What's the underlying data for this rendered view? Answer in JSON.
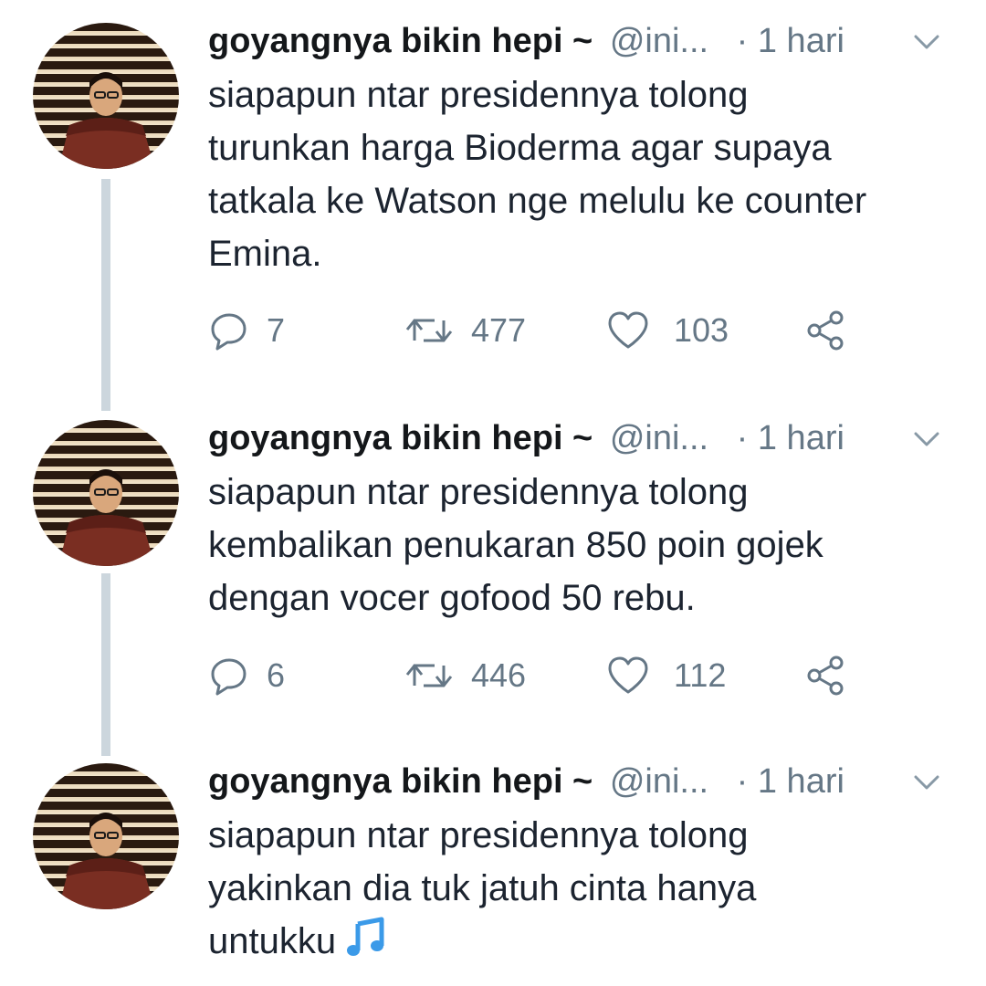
{
  "tweets": [
    {
      "display_name": "goyangnya bikin hepi ~",
      "handle": "@ini...",
      "time": "· 1 hari",
      "text_lines": [
        "siapapun ntar presidennya tolong",
        "turunkan harga Bioderma agar supaya",
        "tatkala ke Watson nge melulu ke counter",
        "Emina."
      ],
      "replies": "7",
      "retweets": "477",
      "likes": "103"
    },
    {
      "display_name": "goyangnya bikin hepi ~",
      "handle": "@ini...",
      "time": "· 1 hari",
      "text_lines": [
        "siapapun ntar presidennya tolong",
        "kembalikan penukaran 850 poin gojek",
        "dengan vocer gofood 50 rebu."
      ],
      "replies": "6",
      "retweets": "446",
      "likes": "112"
    },
    {
      "display_name": "goyangnya bikin hepi ~",
      "handle": "@ini...",
      "time": "· 1 hari",
      "text_lines": [
        "siapapun ntar presidennya tolong",
        "yakinkan dia tuk jatuh cinta hanya",
        "untukku"
      ],
      "emoji": "music-note-icon"
    }
  ],
  "colors": {
    "thread_line": "#ccd6dd",
    "secondary_text": "#657786",
    "emoji_blue": "#3b9ae8"
  }
}
